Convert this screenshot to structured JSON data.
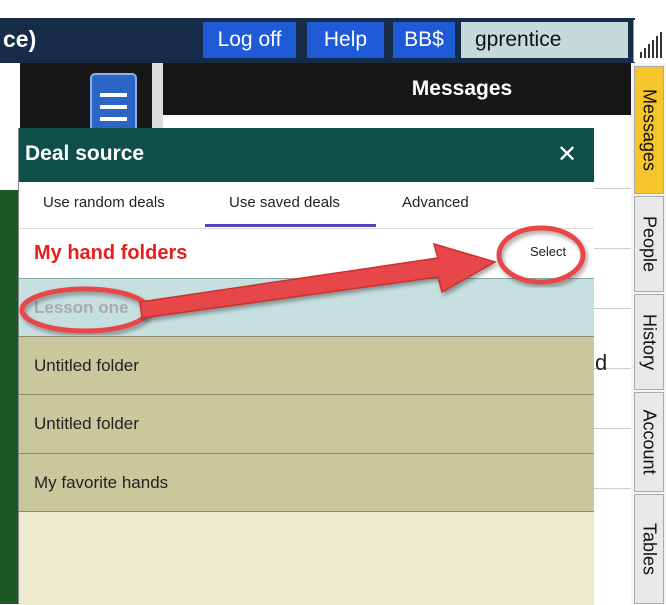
{
  "header": {
    "app_title": "ce)",
    "logoff_label": "Log off",
    "help_label": "Help",
    "bbs_label": "BB$",
    "username": "gprentice"
  },
  "messages_panel": {
    "title": "Messages",
    "partial_char": "d"
  },
  "side_tabs": [
    {
      "label": "Messages",
      "active": true
    },
    {
      "label": "People",
      "active": false
    },
    {
      "label": "History",
      "active": false
    },
    {
      "label": "Account",
      "active": false
    },
    {
      "label": "Tables",
      "active": false
    }
  ],
  "dialog": {
    "title": "Deal source",
    "close_glyph": "✕",
    "tabs": [
      {
        "label": "Use random deals"
      },
      {
        "label": "Use saved deals"
      },
      {
        "label": "Advanced"
      }
    ],
    "active_tab": "Use saved deals",
    "folders_heading": "My hand folders",
    "select_label": "Select",
    "folders": [
      {
        "label": "Lesson one",
        "selected": true
      },
      {
        "label": "Untitled folder",
        "selected": false
      },
      {
        "label": "Untitled folder",
        "selected": false
      },
      {
        "label": "My favorite hands",
        "selected": false
      }
    ]
  },
  "colors": {
    "header_bg": "#172c49",
    "button_blue": "#1f5bd6",
    "dialog_header": "#0e4f4a",
    "heading_red": "#e5201e",
    "annotation_red": "#e8474a",
    "folder_row": "#c9c89c",
    "selected_row": "#c6dfdf",
    "active_tab": "#f6c42b"
  }
}
